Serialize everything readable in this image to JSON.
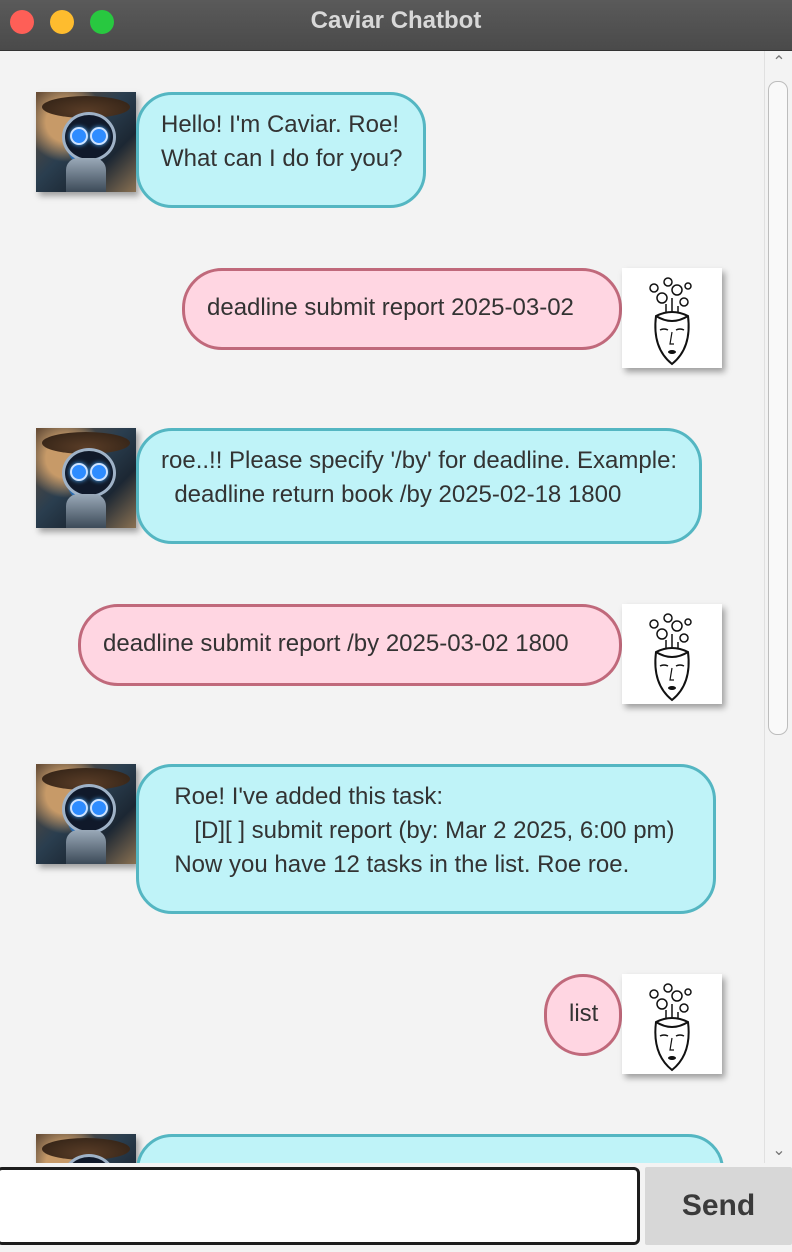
{
  "window": {
    "title": "Caviar Chatbot"
  },
  "messages": [
    {
      "sender": "bot",
      "text": "Hello! I'm Caviar. Roe!\nWhat can I do for you?"
    },
    {
      "sender": "user",
      "text": "deadline submit report 2025-03-02"
    },
    {
      "sender": "bot",
      "text": "roe..!! Please specify '/by' for deadline. Example:\n  deadline return book /by 2025-02-18 1800"
    },
    {
      "sender": "user",
      "text": "deadline submit report /by 2025-03-02 1800"
    },
    {
      "sender": "bot",
      "text": "  Roe! I've added this task:\n     [D][ ] submit report (by: Mar 2 2025, 6:00 pm)\n  Now you have 12 tasks in the list. Roe roe."
    },
    {
      "sender": "user",
      "text": "list"
    },
    {
      "sender": "bot",
      "text": ""
    }
  ],
  "input": {
    "value": "",
    "placeholder": ""
  },
  "send_button": {
    "label": "Send"
  },
  "scrollbar": {
    "up_glyph": "⌃",
    "down_glyph": "⌄"
  }
}
